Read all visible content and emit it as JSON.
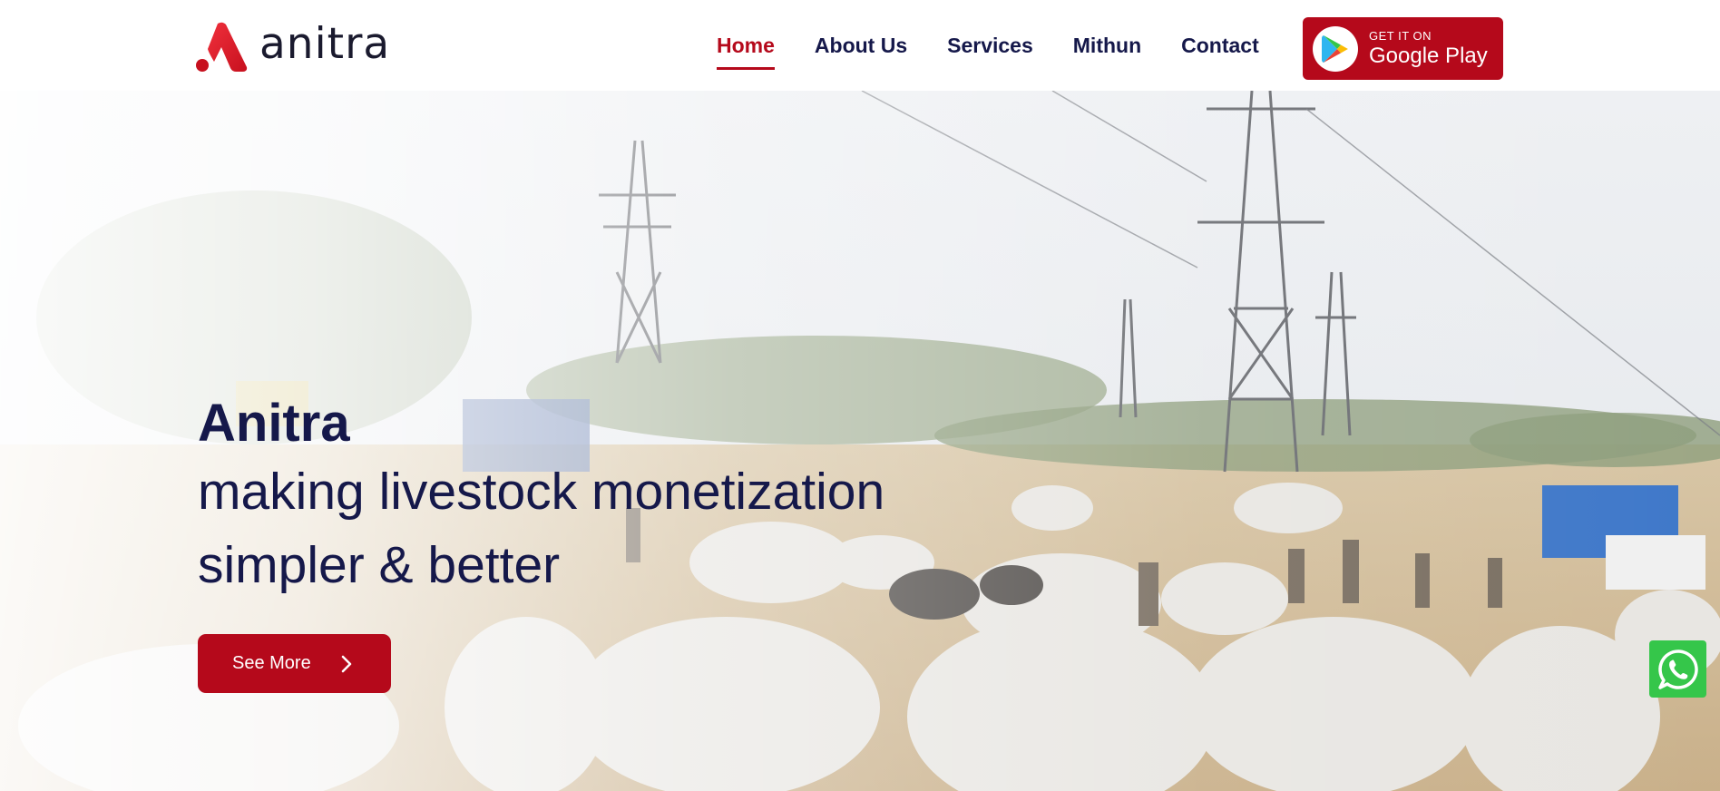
{
  "brand": {
    "name": "anitra",
    "logo_icon": "anitra-logo-icon",
    "accent": "#b5091b"
  },
  "nav": {
    "items": [
      {
        "label": "Home",
        "active": true
      },
      {
        "label": "About Us",
        "active": false
      },
      {
        "label": "Services",
        "active": false
      },
      {
        "label": "Mithun",
        "active": false
      },
      {
        "label": "Contact",
        "active": false
      }
    ]
  },
  "google_play": {
    "small": "GET IT ON",
    "big": "Google Play",
    "icon": "google-play-icon"
  },
  "hero": {
    "title": "Anitra",
    "subtitle_line1": "making livestock monetization",
    "subtitle_line2": "simpler & better",
    "button_label": "See More",
    "button_icon": "chevron-right-icon",
    "background": "livestock market with cattle and power towers"
  },
  "floating": {
    "whatsapp_icon": "whatsapp-icon",
    "color": "#35c64a"
  },
  "colors": {
    "navy": "#15184a",
    "red": "#b5091b"
  }
}
